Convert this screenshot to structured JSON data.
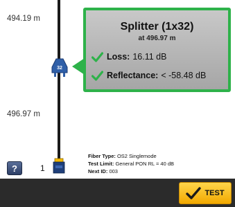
{
  "trace": {
    "distance_top": "494.19 m",
    "distance_bottom": "496.97 m",
    "port_number": "1"
  },
  "splitter_icon": {
    "icon": "splitter-icon",
    "label": "32",
    "color": "#2f5fa8"
  },
  "event": {
    "title": "Splitter (1x32)",
    "subtitle": "at 496.97 m",
    "loss_label": "Loss:",
    "loss_value": "16.11 dB",
    "reflectance_label": "Reflectance:",
    "reflectance_value": "< -58.48 dB",
    "status_icon": "check-icon",
    "border_color": "#2eb24a"
  },
  "fiber": {
    "type_label": "Fiber Type:",
    "type_value": "OS2 Singlemode",
    "limit_label": "Test Limit:",
    "limit_value": "General PON RL = 40 dB",
    "next_id_label": "Next ID:",
    "next_id_value": "003"
  },
  "help": {
    "label": "?",
    "icon": "help-icon"
  },
  "toolbar": {
    "test_label": "TEST",
    "test_icon": "check-icon",
    "test_color": "#f5b800"
  }
}
